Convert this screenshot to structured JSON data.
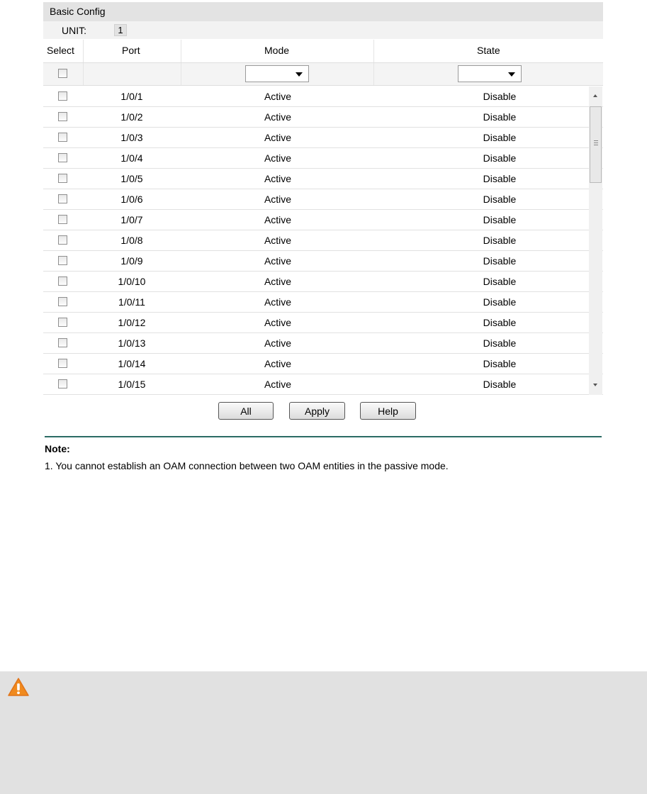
{
  "panel": {
    "title": "Basic Config"
  },
  "unit": {
    "label": "UNIT:",
    "value": "1"
  },
  "table": {
    "headers": {
      "select": "Select",
      "port": "Port",
      "mode": "Mode",
      "state": "State"
    },
    "rows": [
      {
        "port": "1/0/1",
        "mode": "Active",
        "state": "Disable"
      },
      {
        "port": "1/0/2",
        "mode": "Active",
        "state": "Disable"
      },
      {
        "port": "1/0/3",
        "mode": "Active",
        "state": "Disable"
      },
      {
        "port": "1/0/4",
        "mode": "Active",
        "state": "Disable"
      },
      {
        "port": "1/0/5",
        "mode": "Active",
        "state": "Disable"
      },
      {
        "port": "1/0/6",
        "mode": "Active",
        "state": "Disable"
      },
      {
        "port": "1/0/7",
        "mode": "Active",
        "state": "Disable"
      },
      {
        "port": "1/0/8",
        "mode": "Active",
        "state": "Disable"
      },
      {
        "port": "1/0/9",
        "mode": "Active",
        "state": "Disable"
      },
      {
        "port": "1/0/10",
        "mode": "Active",
        "state": "Disable"
      },
      {
        "port": "1/0/11",
        "mode": "Active",
        "state": "Disable"
      },
      {
        "port": "1/0/12",
        "mode": "Active",
        "state": "Disable"
      },
      {
        "port": "1/0/13",
        "mode": "Active",
        "state": "Disable"
      },
      {
        "port": "1/0/14",
        "mode": "Active",
        "state": "Disable"
      },
      {
        "port": "1/0/15",
        "mode": "Active",
        "state": "Disable"
      }
    ]
  },
  "buttons": {
    "all": "All",
    "apply": "Apply",
    "help": "Help"
  },
  "note": {
    "title": "Note:",
    "text": "1. You cannot establish an OAM connection between two OAM entities in the passive mode."
  },
  "icons": {
    "warning": "warning-icon",
    "dropdown": "chevron-down-icon"
  },
  "colors": {
    "rule": "#2b6b64",
    "warning": "#f08a1e",
    "header_bg": "#e3e3e3"
  }
}
